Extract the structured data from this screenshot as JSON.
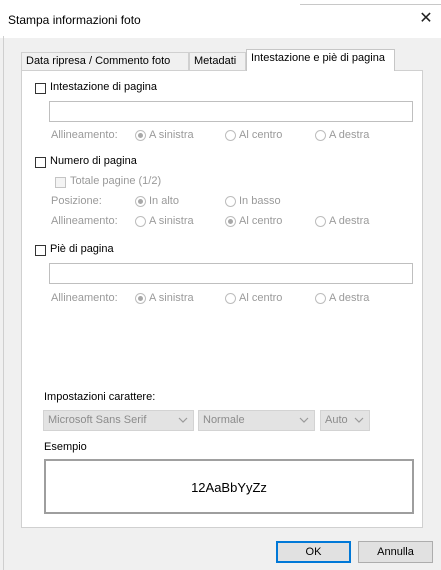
{
  "window": {
    "title": "Stampa informazioni foto",
    "close_glyph": "✕"
  },
  "tabs": [
    {
      "label": "Data ripresa / Commento foto",
      "active": false
    },
    {
      "label": "Metadati",
      "active": false
    },
    {
      "label": "Intestazione e piè di pagina",
      "active": true
    }
  ],
  "header": {
    "checkbox_label": "Intestazione di pagina",
    "checked": false,
    "text_value": "",
    "alignment_label": "Allineamento:",
    "alignment_options": [
      "A sinistra",
      "Al centro",
      "A destra"
    ],
    "alignment_selected": "A sinistra"
  },
  "page_number": {
    "checkbox_label": "Numero di pagina",
    "checked": false,
    "total_label": "Totale pagine (1/2)",
    "total_checked": false,
    "position_label": "Posizione:",
    "position_options": [
      "In alto",
      "In basso"
    ],
    "position_selected": "In alto",
    "alignment_label": "Allineamento:",
    "alignment_options": [
      "A sinistra",
      "Al centro",
      "A destra"
    ],
    "alignment_selected": "Al centro"
  },
  "footer": {
    "checkbox_label": "Piè di pagina",
    "checked": false,
    "text_value": "",
    "alignment_label": "Allineamento:",
    "alignment_options": [
      "A sinistra",
      "Al centro",
      "A destra"
    ],
    "alignment_selected": "A sinistra"
  },
  "font_settings": {
    "label": "Impostazioni carattere:",
    "font_value": "Microsoft Sans Serif",
    "style_value": "Normale",
    "size_value": "Auto",
    "chevron_icon": "chevron-down-icon"
  },
  "sample": {
    "label": "Esempio",
    "text": "12AaBbYyZz"
  },
  "buttons": {
    "ok": "OK",
    "cancel": "Annulla"
  },
  "colors": {
    "default_button_border": "#0078d7",
    "disabled_text": "#9a9a9a"
  }
}
